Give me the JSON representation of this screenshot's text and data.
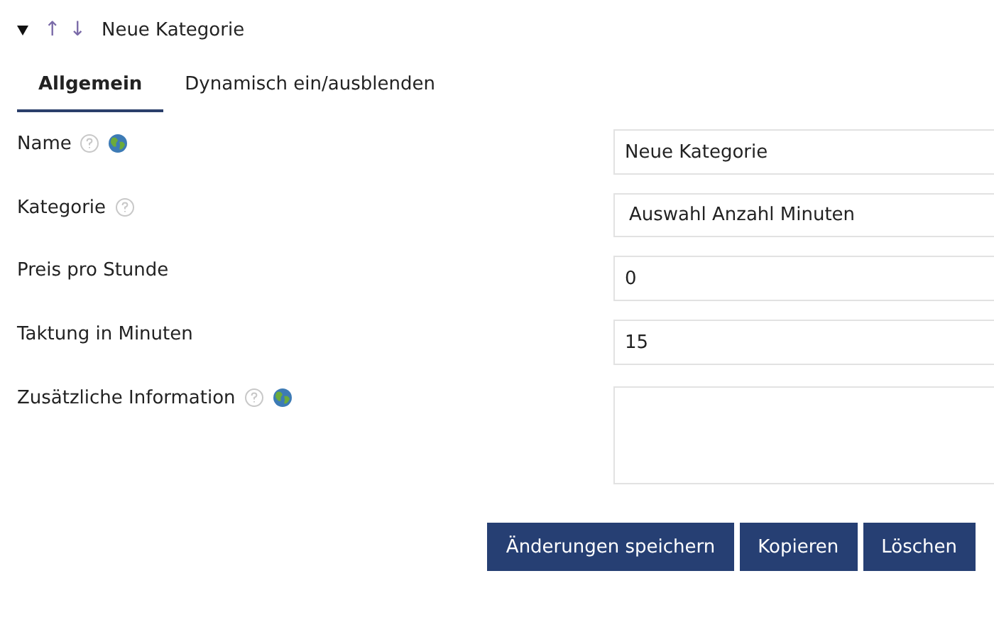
{
  "header": {
    "expanded": true,
    "move_up": "↑",
    "move_down": "↓",
    "title": "Neue Kategorie"
  },
  "tabs": [
    {
      "label": "Allgemein",
      "selected": true
    },
    {
      "label": "Dynamisch ein/ausblenden",
      "selected": false
    }
  ],
  "fields": [
    {
      "label": "Name",
      "help": true,
      "translatable": true,
      "kind": "text",
      "value": "Neue Kategorie"
    },
    {
      "label": "Kategorie",
      "help": true,
      "translatable": false,
      "kind": "select",
      "value": "Auswahl Anzahl Minuten"
    },
    {
      "label": "Preis pro Stunde",
      "help": false,
      "translatable": false,
      "kind": "text",
      "value": "0"
    },
    {
      "label": "Taktung in Minuten",
      "help": false,
      "translatable": false,
      "kind": "text",
      "value": "15"
    },
    {
      "label": "Zusätzliche Information",
      "help": true,
      "translatable": true,
      "kind": "textarea"
    }
  ],
  "buttons": [
    "Änderungen speichern",
    "Kopieren",
    "Löschen"
  ]
}
